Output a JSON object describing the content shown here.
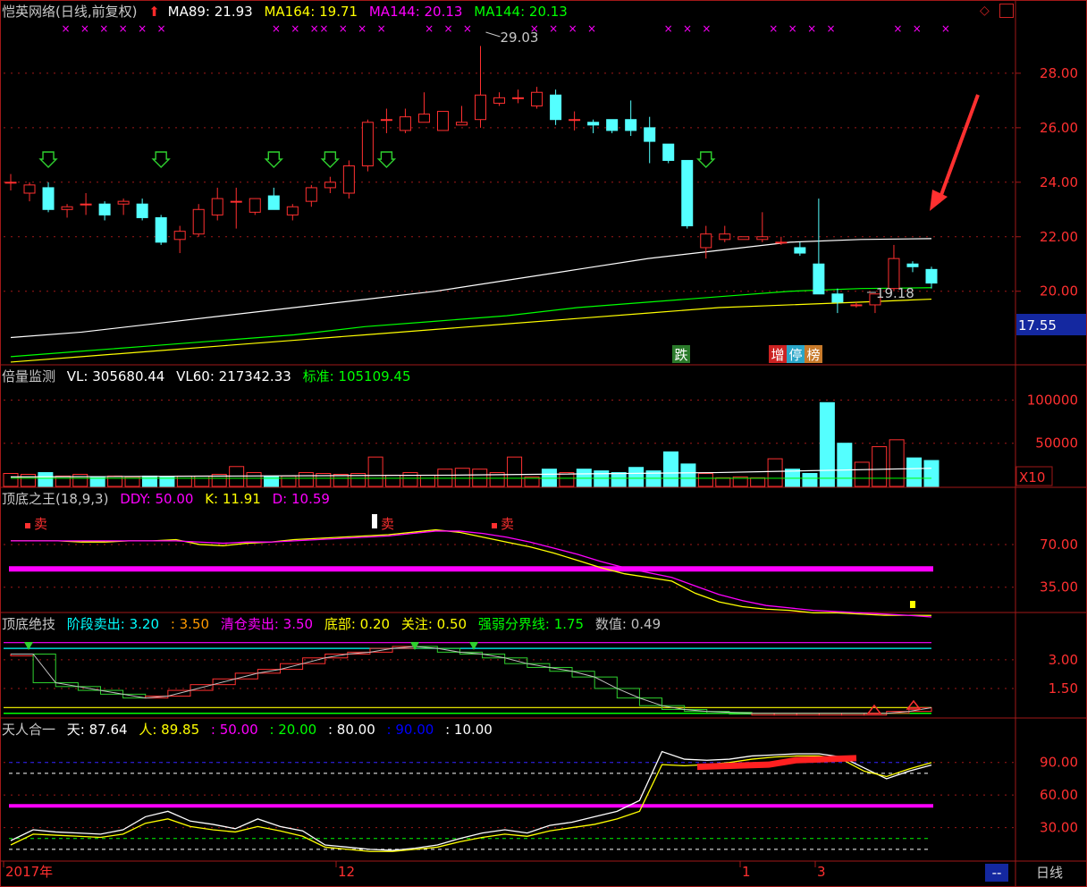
{
  "stock": {
    "title": "恺英网络(日线,前复权)",
    "ma": [
      {
        "label": "MA89: 21.93",
        "color": "#ffffff"
      },
      {
        "label": "MA164: 19.71",
        "color": "#ffff00"
      },
      {
        "label": "MA144: 20.13",
        "color": "#ff00ff"
      },
      {
        "label": "MA144: 20.13",
        "color": "#00ff00"
      }
    ],
    "high_marker": "29.03",
    "low_marker": "19.18",
    "price_ticks": [
      "28.00",
      "26.00",
      "24.00",
      "22.00",
      "20.00"
    ],
    "current_price": "17.55",
    "badges": [
      {
        "text": "跌",
        "bg": "#2a7a2a"
      },
      {
        "text": "增",
        "bg": "#cc2222"
      },
      {
        "text": "停",
        "bg": "#2aa6c8"
      },
      {
        "text": "榜",
        "bg": "#c87a2a"
      }
    ]
  },
  "volume": {
    "title": "倍量监测",
    "items": [
      {
        "label": "VL: 305680.44",
        "color": "#ffffff"
      },
      {
        "label": "VL60: 217342.33",
        "color": "#ffffff"
      },
      {
        "label": "标准: 105109.45",
        "color": "#00ff00"
      }
    ],
    "ticks": [
      "100000",
      "50000"
    ],
    "unit": "X10"
  },
  "kd": {
    "title": "顶底之王",
    "params": "(18,9,3)",
    "items": [
      {
        "label": "DDY: 50.00",
        "color": "#ff00ff"
      },
      {
        "label": "K: 11.91",
        "color": "#ffff00"
      },
      {
        "label": "D: 10.59",
        "color": "#ff00ff"
      }
    ],
    "ticks": [
      "70.00",
      "35.00"
    ],
    "sell_label": "卖"
  },
  "stage": {
    "title": "顶底绝技",
    "items": [
      {
        "label": "阶段卖出: 3.20",
        "color": "#00ffff"
      },
      {
        "label": ": 3.50",
        "color": "#ff9900"
      },
      {
        "label": "清仓卖出: 3.50",
        "color": "#ff00ff"
      },
      {
        "label": "底部: 0.20",
        "color": "#ffff00"
      },
      {
        "label": "关注: 0.50",
        "color": "#ffff00"
      },
      {
        "label": "强弱分界线: 1.75",
        "color": "#00ff00"
      },
      {
        "label": "数值: 0.49",
        "color": "#c0c0c0"
      }
    ],
    "ticks": [
      "3.00",
      "1.50"
    ]
  },
  "tianren": {
    "title": "天人合一",
    "items": [
      {
        "label": "天: 87.64",
        "color": "#ffffff"
      },
      {
        "label": "人: 89.85",
        "color": "#ffff00"
      },
      {
        "label": ": 50.00",
        "color": "#ff00ff"
      },
      {
        "label": ": 20.00",
        "color": "#00ff00"
      },
      {
        "label": ": 80.00",
        "color": "#ffffff"
      },
      {
        "label": ": 90.00",
        "color": "#0000ff"
      },
      {
        "label": ": 10.00",
        "color": "#ffffff"
      }
    ],
    "ticks": [
      "90.00",
      "60.00",
      "30.00"
    ]
  },
  "time_axis": {
    "labels": [
      "2017年",
      "12",
      "1",
      "3"
    ],
    "period": "日线",
    "scroll": "--"
  },
  "chart_data": [
    {
      "type": "candlestick",
      "ylim": [
        17.3,
        29.9
      ],
      "series_ohlc": [
        [
          24.0,
          24.3,
          23.7,
          24.0
        ],
        [
          23.6,
          24.0,
          23.3,
          23.9
        ],
        [
          23.8,
          24.0,
          22.9,
          23.0
        ],
        [
          23.0,
          23.2,
          22.7,
          23.1
        ],
        [
          23.2,
          23.6,
          22.8,
          23.2
        ],
        [
          23.2,
          23.3,
          22.6,
          22.8
        ],
        [
          23.2,
          23.4,
          22.8,
          23.3
        ],
        [
          23.2,
          23.4,
          22.6,
          22.7
        ],
        [
          22.7,
          22.8,
          21.7,
          21.8
        ],
        [
          21.9,
          22.4,
          21.4,
          22.2
        ],
        [
          22.1,
          23.2,
          22.0,
          23.0
        ],
        [
          22.8,
          23.8,
          22.6,
          23.4
        ],
        [
          23.3,
          23.8,
          22.3,
          23.3
        ],
        [
          22.9,
          23.4,
          22.8,
          23.4
        ],
        [
          23.5,
          23.8,
          23.0,
          23.0
        ],
        [
          22.8,
          23.2,
          22.6,
          23.1
        ],
        [
          23.3,
          23.9,
          23.1,
          23.8
        ],
        [
          23.8,
          24.2,
          23.6,
          24.0
        ],
        [
          23.6,
          24.8,
          23.4,
          24.6
        ],
        [
          24.6,
          26.3,
          24.4,
          26.2
        ],
        [
          26.3,
          26.7,
          25.8,
          26.3
        ],
        [
          25.9,
          26.7,
          25.8,
          26.4
        ],
        [
          26.2,
          27.3,
          26.2,
          26.5
        ],
        [
          25.9,
          26.6,
          25.9,
          26.6
        ],
        [
          26.1,
          26.8,
          26.1,
          26.2
        ],
        [
          26.3,
          29.0,
          26.0,
          27.2
        ],
        [
          26.9,
          27.3,
          26.8,
          27.1
        ],
        [
          27.1,
          27.4,
          26.9,
          27.1
        ],
        [
          26.8,
          27.5,
          26.7,
          27.3
        ],
        [
          27.2,
          27.4,
          26.1,
          26.3
        ],
        [
          26.3,
          26.6,
          25.9,
          26.3
        ],
        [
          26.2,
          26.3,
          25.8,
          26.1
        ],
        [
          26.3,
          26.3,
          25.8,
          25.9
        ],
        [
          26.3,
          27.0,
          25.7,
          25.9
        ],
        [
          26.0,
          26.4,
          24.7,
          25.5
        ],
        [
          25.4,
          25.4,
          24.7,
          24.8
        ],
        [
          24.8,
          24.8,
          22.3,
          22.4
        ],
        [
          21.6,
          22.4,
          21.2,
          22.1
        ],
        [
          21.9,
          22.4,
          21.8,
          22.1
        ],
        [
          21.9,
          22.0,
          21.9,
          22.0
        ],
        [
          21.9,
          22.9,
          21.8,
          22.0
        ],
        [
          21.8,
          22.0,
          21.7,
          21.8
        ],
        [
          21.6,
          21.8,
          21.3,
          21.4
        ],
        [
          21.0,
          23.4,
          19.9,
          19.9
        ],
        [
          19.9,
          20.1,
          19.2,
          19.6
        ],
        [
          19.5,
          19.6,
          19.4,
          19.5
        ],
        [
          19.5,
          19.9,
          19.2,
          19.9
        ],
        [
          20.1,
          21.7,
          20.0,
          21.2
        ],
        [
          21.0,
          21.1,
          20.7,
          20.9
        ],
        [
          20.8,
          20.9,
          20.1,
          20.3
        ]
      ],
      "ma_series": [
        {
          "name": "MA89",
          "color": "#ffffff",
          "values": [
            18.3,
            18.5,
            18.8,
            19.1,
            19.4,
            19.7,
            20.0,
            20.4,
            20.8,
            21.2,
            21.5,
            21.8,
            21.9,
            21.93
          ]
        },
        {
          "name": "MA164",
          "color": "#ffff00",
          "values": [
            17.4,
            17.6,
            17.8,
            18.0,
            18.2,
            18.4,
            18.6,
            18.8,
            19.0,
            19.2,
            19.4,
            19.5,
            19.6,
            19.71
          ]
        },
        {
          "name": "MA144",
          "color": "#00ff00",
          "values": [
            17.6,
            17.8,
            18.0,
            18.2,
            18.4,
            18.7,
            18.9,
            19.1,
            19.4,
            19.6,
            19.8,
            20.0,
            20.1,
            20.13
          ]
        }
      ]
    },
    {
      "type": "bar",
      "ylim": [
        0,
        118000
      ],
      "values": [
        15000,
        14000,
        16000,
        12000,
        14000,
        11000,
        12000,
        11000,
        12000,
        11000,
        12000,
        12000,
        14000,
        23000,
        16000,
        12000,
        12000,
        16000,
        15000,
        14000,
        15000,
        34000,
        13000,
        16000,
        13000,
        20000,
        21000,
        20000,
        16000,
        34000,
        11000,
        20000,
        16000,
        20000,
        18000,
        16000,
        22000,
        18000,
        40000,
        26000,
        15000,
        10000,
        11000,
        10000,
        32000,
        20000,
        15000,
        97000,
        50000,
        28000,
        46000,
        54000,
        33000,
        30000
      ]
    },
    {
      "type": "line",
      "ylim": [
        15,
        100
      ],
      "series": [
        {
          "name": "K",
          "color": "#ffff00",
          "values": [
            73,
            73,
            73,
            72,
            72,
            73,
            73,
            74,
            70,
            69,
            71,
            72,
            74,
            75,
            76,
            77,
            78,
            80,
            82,
            80,
            76,
            72,
            68,
            63,
            57,
            51,
            46,
            43,
            40,
            30,
            23,
            19,
            17,
            16,
            14,
            14,
            13,
            12,
            12,
            11.91
          ]
        },
        {
          "name": "D",
          "color": "#ff00ff",
          "values": [
            73,
            73,
            73,
            73,
            73,
            73,
            73,
            73,
            72,
            71,
            72,
            72,
            73,
            74,
            75,
            76,
            77,
            79,
            81,
            81,
            79,
            76,
            72,
            67,
            62,
            56,
            51,
            47,
            43,
            36,
            29,
            24,
            20,
            18,
            16,
            15,
            14,
            13,
            12,
            10.59
          ]
        }
      ]
    },
    {
      "type": "step",
      "ylim": [
        0,
        4.4
      ],
      "series": [
        {
          "name": "数值",
          "values": [
            3.3,
            3.3,
            1.8,
            1.6,
            1.4,
            1.2,
            1.0,
            1.1,
            1.4,
            1.7,
            2.0,
            2.3,
            2.5,
            2.8,
            3.1,
            3.3,
            3.4,
            3.6,
            3.7,
            3.6,
            3.4,
            3.3,
            3.1,
            2.8,
            2.6,
            2.4,
            2.1,
            1.5,
            1.0,
            0.6,
            0.4,
            0.3,
            0.25,
            0.2,
            0.2,
            0.2,
            0.2,
            0.2,
            0.2,
            0.2,
            0.3,
            0.49
          ]
        }
      ]
    },
    {
      "type": "line",
      "ylim": [
        0,
        112
      ],
      "series": [
        {
          "name": "天",
          "color": "#ffffff",
          "values": [
            18,
            28,
            26,
            25,
            24,
            28,
            40,
            45,
            36,
            33,
            29,
            38,
            31,
            27,
            14,
            12,
            10,
            9,
            11,
            14,
            20,
            25,
            28,
            25,
            32,
            35,
            40,
            45,
            55,
            100,
            93,
            92,
            93,
            96,
            97,
            98,
            98,
            95,
            85,
            75,
            82,
            87.64
          ]
        },
        {
          "name": "人",
          "color": "#ffff00",
          "values": [
            14,
            24,
            23,
            22,
            21,
            24,
            34,
            38,
            31,
            28,
            26,
            31,
            27,
            22,
            12,
            10,
            8,
            8,
            10,
            12,
            17,
            21,
            24,
            22,
            27,
            30,
            33,
            38,
            45,
            88,
            87,
            88,
            90,
            93,
            95,
            96,
            96,
            93,
            82,
            77,
            84,
            89.85
          ]
        }
      ]
    }
  ]
}
